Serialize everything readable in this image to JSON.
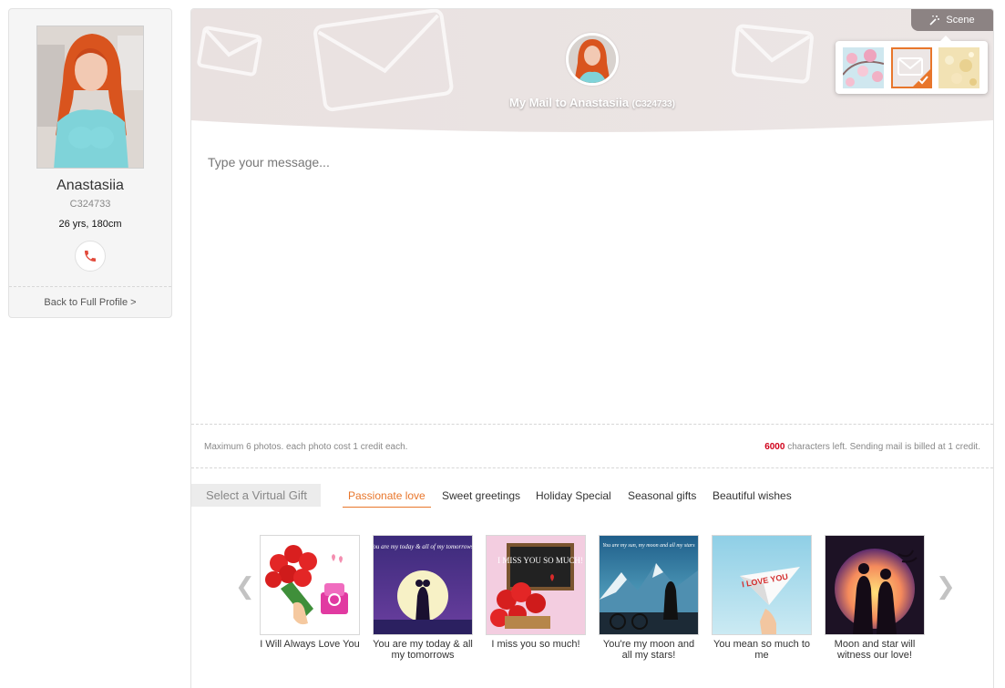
{
  "profile": {
    "name": "Anastasiia",
    "id": "C324733",
    "stats": "26 yrs, 180cm",
    "back_link": "Back to Full Profile >",
    "icons": {
      "call": "phone-icon",
      "photo": "profile-photo"
    }
  },
  "compose": {
    "title": "My Mail to Anastasiia",
    "title_code": "(C324733)",
    "scene_label": "Scene",
    "scene_icon": "magic-wand-icon",
    "scenes": [
      "cherry-blossom",
      "envelope-pattern",
      "golden-sparkle"
    ],
    "selected_scene": "envelope-pattern",
    "placeholder": "Type your message...",
    "photo_info": "Maximum 6 photos. each photo cost 1 credit each.",
    "chars_left": "6000",
    "chars_info": "characters left. Sending mail is billed at 1 credit."
  },
  "gifts": {
    "select_label": "Select a Virtual Gift",
    "tabs": [
      "Passionate love",
      "Sweet greetings",
      "Holiday Special",
      "Seasonal gifts",
      "Beautiful wishes"
    ],
    "active_tab": "Passionate love",
    "prev_icon": "chevron-left-icon",
    "next_icon": "chevron-right-icon",
    "items": [
      {
        "name": "I Will Always Love You"
      },
      {
        "name": "You are my today & all my tomorrows"
      },
      {
        "name": "I miss you so much!"
      },
      {
        "name": "You're my moon and all my stars!"
      },
      {
        "name": "You mean so much to me"
      },
      {
        "name": "Moon and star will witness our love!"
      }
    ],
    "image_text": {
      "today": "You are my today & all of my tomorrows!",
      "miss": "I MISS YOU SO MUCH!",
      "moon": "You are my sun, my moon and all my stars",
      "plane": "I LOVE YOU"
    }
  },
  "colors": {
    "accent": "#e8762b",
    "count_red": "#d0021b",
    "scene_tab": "#8c8383",
    "header_bg": "#ebe4e3"
  }
}
